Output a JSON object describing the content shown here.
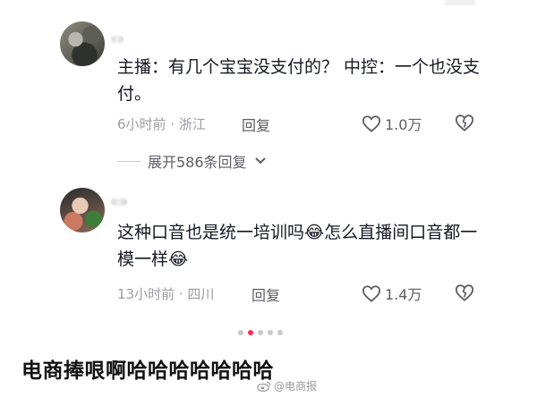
{
  "comments": [
    {
      "content": "主播：有几个宝宝没支付的？ 中控：一个也没支付。",
      "time": "6小时前",
      "location": "浙江",
      "reply_label": "回复",
      "likes": "1.0万",
      "expand_label": "展开586条回复"
    },
    {
      "content_part1": "这种口音也是统一培训吗",
      "content_part2": "怎么直播间口音都一模一样",
      "emoji": "😂",
      "time": "13小时前",
      "location": "四川",
      "reply_label": "回复",
      "likes": "1.4万"
    }
  ],
  "meta_separator": " · ",
  "carousel": {
    "count": 5,
    "active_index": 1
  },
  "caption": "电商捧哏啊哈哈哈哈哈哈哈",
  "watermark": "@电商报",
  "colors": {
    "accent": "#fe2c55",
    "text": "#161823",
    "muted": "#9c9ca4"
  }
}
